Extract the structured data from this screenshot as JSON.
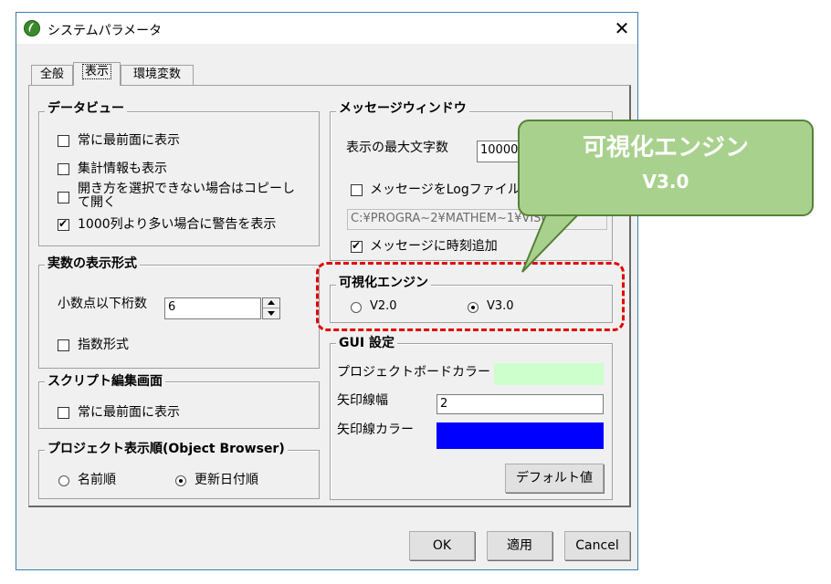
{
  "window": {
    "title": "システムパラメータ",
    "close_glyph": "✕"
  },
  "tabs": [
    {
      "label": "全般"
    },
    {
      "label": "表示"
    },
    {
      "label": "環境変数"
    }
  ],
  "dataview": {
    "legend": "データビュー",
    "items": [
      {
        "label": "常に最前面に表示",
        "checked": false
      },
      {
        "label": "集計情報も表示",
        "checked": false
      },
      {
        "label_line1": "開き方を選択できない場合はコピーし",
        "label_line2": "て開く",
        "checked": false
      },
      {
        "label": "1000列より多い場合に警告を表示",
        "checked": true
      }
    ]
  },
  "realnum": {
    "legend": "実数の表示形式",
    "decimals_label": "小数点以下桁数",
    "decimals_value": "6",
    "exponent_label": "指数形式",
    "exponent_checked": false
  },
  "script": {
    "legend": "スクリプト編集画面",
    "topmost_label": "常に最前面に表示"
  },
  "project_order": {
    "legend": "プロジェクト表示順(Object Browser)",
    "options": [
      {
        "label": "名前順",
        "selected": false
      },
      {
        "label": "更新日付順",
        "selected": true
      }
    ]
  },
  "message": {
    "legend": "メッセージウィンドウ",
    "maxchars_label": "表示の最大文字数",
    "maxchars_value": "10000",
    "log_label": "メッセージをLogファイルに累積",
    "log_path": "C:¥PROGRA~2¥MATHEM~1¥VISU",
    "timestamp_label": "メッセージに時刻追加"
  },
  "engine": {
    "legend": "可視化エンジン",
    "options": [
      {
        "label": "V2.0",
        "selected": false
      },
      {
        "label": "V3.0",
        "selected": true
      }
    ]
  },
  "gui": {
    "legend": "GUI 設定",
    "board_color_label": "プロジェクトボードカラー",
    "board_color": "#ccffcc",
    "arrow_width_label": "矢印線幅",
    "arrow_width_value": "2",
    "arrow_color_label": "矢印線カラー",
    "arrow_color": "#0000ff",
    "default_button": "デフォルト値"
  },
  "footer": {
    "ok": "OK",
    "apply": "適用",
    "cancel": "Cancel"
  },
  "callout": {
    "title": "可視化エンジン",
    "subtitle": "V3.0"
  }
}
